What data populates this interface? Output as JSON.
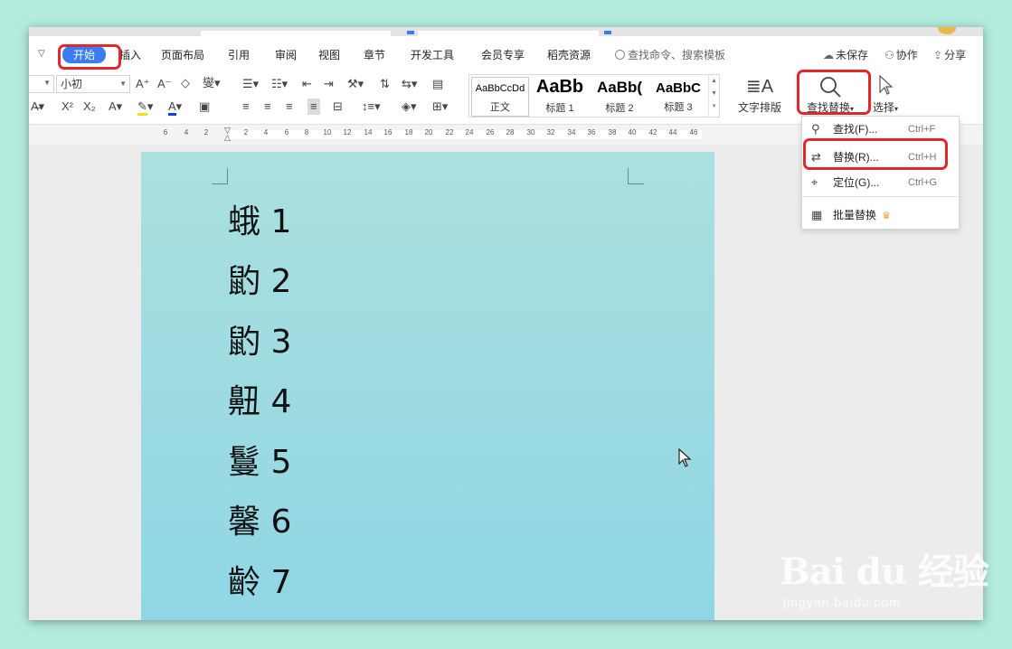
{
  "menu": {
    "items": [
      "开始",
      "插入",
      "页面布局",
      "引用",
      "审阅",
      "视图",
      "章节",
      "开发工具",
      "会员专享",
      "稻壳资源"
    ],
    "search_placeholder": "查找命令、搜索模板",
    "unsaved": "未保存",
    "collaborate": "协作",
    "share": "分享"
  },
  "ribbon": {
    "font_size": "小初",
    "styles": [
      {
        "sample": "AaBbCcDd",
        "name": "正文"
      },
      {
        "sample": "AaBb",
        "name": "标题 1"
      },
      {
        "sample": "AaBb(",
        "name": "标题 2"
      },
      {
        "sample": "AaBbC",
        "name": "标题 3"
      }
    ],
    "text_layout": "文字排版",
    "find_replace": "查找替换",
    "select": "选择"
  },
  "ruler": {
    "numbers": [
      "6",
      "4",
      "2",
      "2",
      "4",
      "6",
      "8",
      "10",
      "12",
      "14",
      "16",
      "18",
      "20",
      "22",
      "24",
      "26",
      "28",
      "30",
      "32",
      "34",
      "36",
      "38",
      "40",
      "42",
      "44",
      "46"
    ]
  },
  "document": {
    "lines": [
      "蛾 1",
      "䶂 2",
      "䶂 3",
      "䶊 4",
      "鬘 5",
      "馨 6",
      "齡 7"
    ]
  },
  "dropdown": {
    "items": [
      {
        "label": "查找(F)...",
        "shortcut": "Ctrl+F"
      },
      {
        "label": "替换(R)...",
        "shortcut": "Ctrl+H"
      },
      {
        "label": "定位(G)...",
        "shortcut": "Ctrl+G"
      },
      {
        "label": "批量替换",
        "shortcut": ""
      }
    ]
  },
  "watermark": {
    "logo": "Bai du 经验",
    "url": "jingyan.baidu.com"
  },
  "colors": {
    "accent": "#3b7cf2",
    "highlight_box": "#e3282c"
  }
}
